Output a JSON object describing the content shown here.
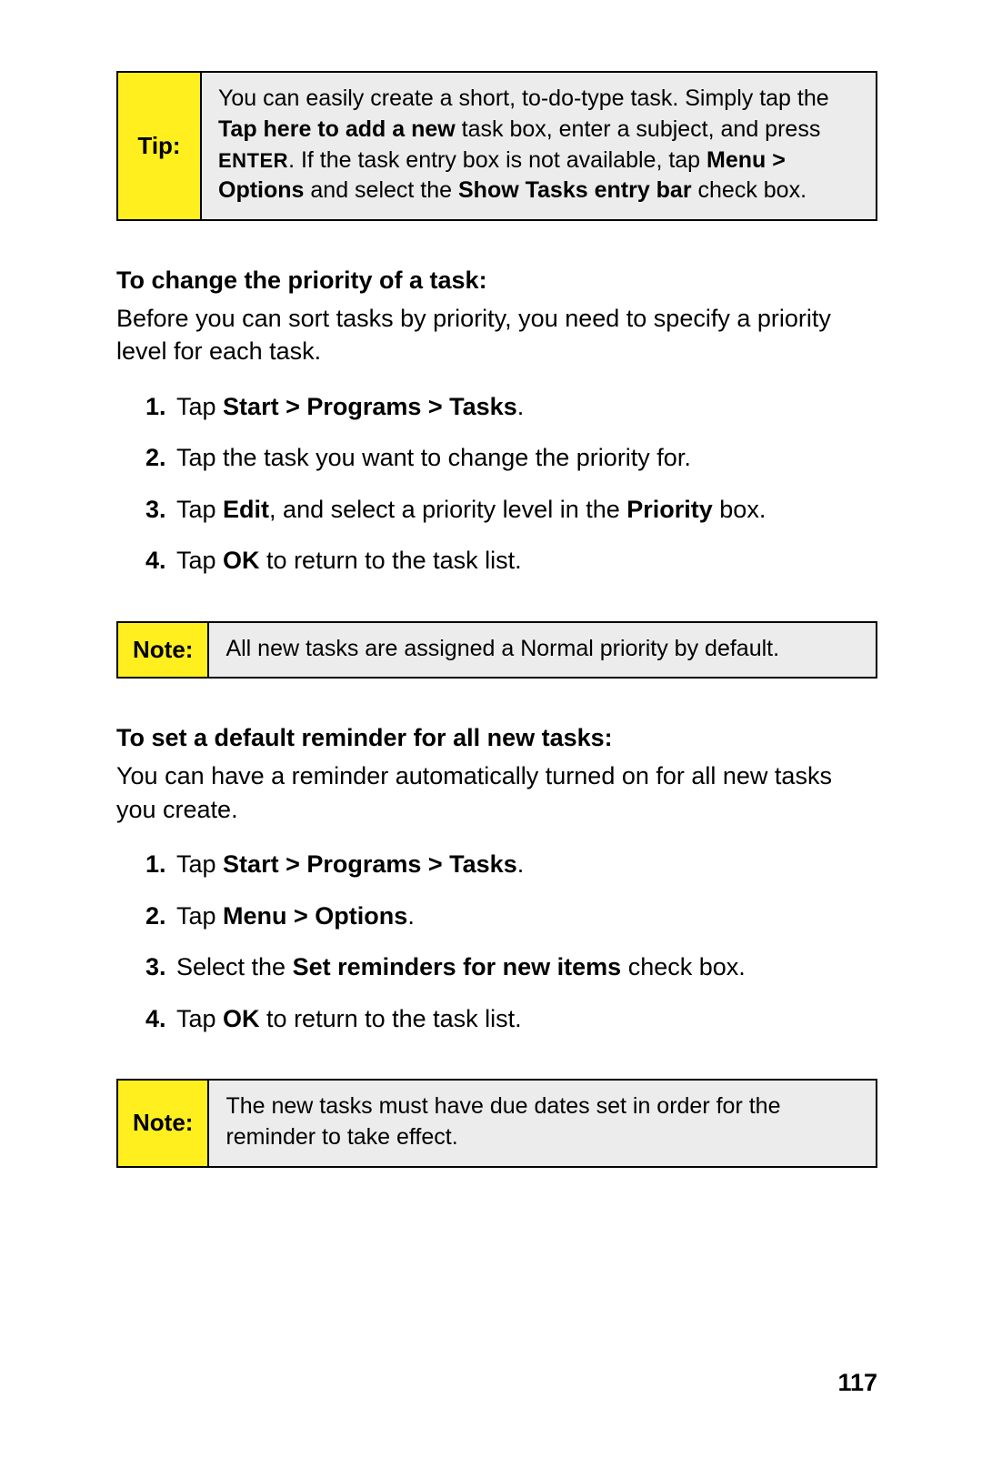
{
  "tip": {
    "label": "Tip:",
    "body_html": "You can easily create a short, to-do-type task. Simply tap the <span class='b'>Tap here to add a new</span> task box, enter a subject, and press <span class='enter'>ENTER</span>. If the task entry box is not available, tap <span class='b'>Menu &gt; Options</span> and select the <span class='b'>Show Tasks entry bar</span> check box."
  },
  "section1": {
    "heading": "To change the priority of a task:",
    "intro": "Before you can sort tasks by priority, you need to specify a priority level for each task.",
    "steps": [
      "Tap <span class='b'>Start &gt; Programs &gt; Tasks</span>.",
      "Tap the task you want to change the priority for.",
      "Tap <span class='b'>Edit</span>, and select a priority level in the <span class='b'>Priority</span> box.",
      "Tap <span class='b'>OK</span> to return to the task list."
    ]
  },
  "note1": {
    "label": "Note:",
    "body_html": "All new tasks are assigned a Normal priority by default."
  },
  "section2": {
    "heading": "To set a default reminder for all new tasks:",
    "intro": "You can have a reminder automatically turned on for all new tasks you create.",
    "steps": [
      "Tap <span class='b'>Start &gt; Programs &gt; Tasks</span>.",
      "Tap <span class='b'>Menu &gt; Options</span>.",
      "Select the <span class='b'>Set reminders for new items</span> check box.",
      "Tap <span class='b'>OK</span> to return to the task list."
    ]
  },
  "note2": {
    "label": "Note:",
    "body_html": "The new tasks must have due dates set in order for the reminder to take effect."
  },
  "page_number": "117"
}
